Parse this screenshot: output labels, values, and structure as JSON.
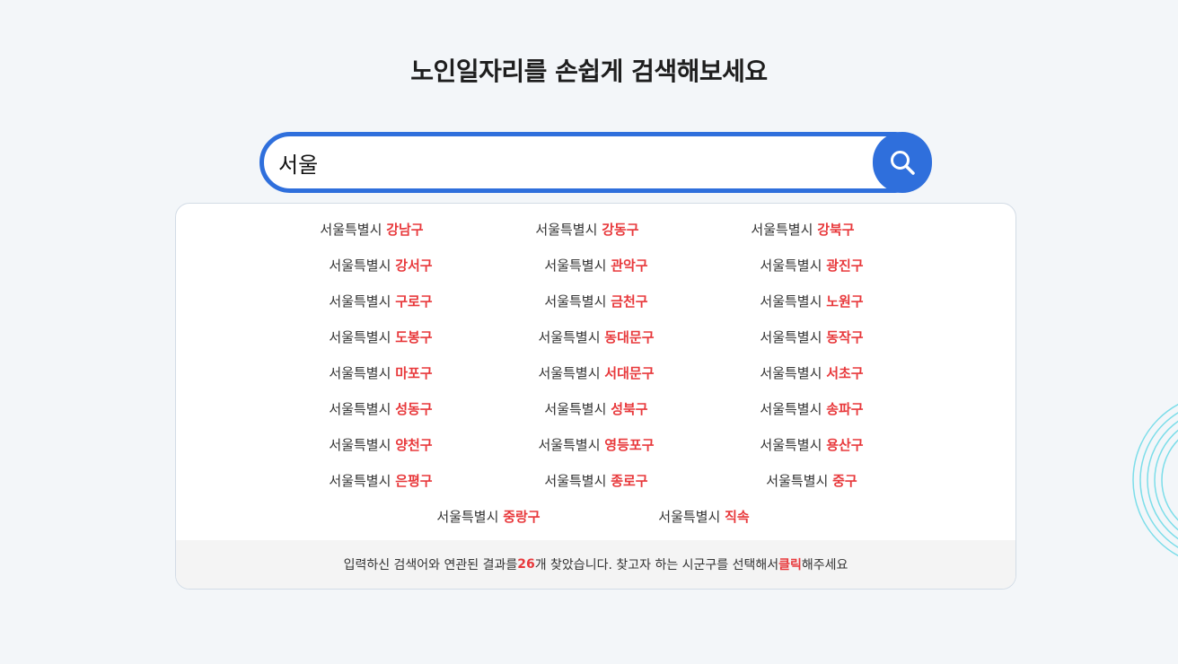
{
  "page": {
    "title": "노인일자리를 손쉽게 검색해보세요"
  },
  "search": {
    "value": "서울"
  },
  "results": [
    {
      "city": "서울특별시",
      "district": "강남구"
    },
    {
      "city": "서울특별시",
      "district": "강동구"
    },
    {
      "city": "서울특별시",
      "district": "강북구"
    },
    {
      "city": "서울특별시",
      "district": "강서구"
    },
    {
      "city": "서울특별시",
      "district": "관악구"
    },
    {
      "city": "서울특별시",
      "district": "광진구"
    },
    {
      "city": "서울특별시",
      "district": "구로구"
    },
    {
      "city": "서울특별시",
      "district": "금천구"
    },
    {
      "city": "서울특별시",
      "district": "노원구"
    },
    {
      "city": "서울특별시",
      "district": "도봉구"
    },
    {
      "city": "서울특별시",
      "district": "동대문구"
    },
    {
      "city": "서울특별시",
      "district": "동작구"
    },
    {
      "city": "서울특별시",
      "district": "마포구"
    },
    {
      "city": "서울특별시",
      "district": "서대문구"
    },
    {
      "city": "서울특별시",
      "district": "서초구"
    },
    {
      "city": "서울특별시",
      "district": "성동구"
    },
    {
      "city": "서울특별시",
      "district": "성북구"
    },
    {
      "city": "서울특별시",
      "district": "송파구"
    },
    {
      "city": "서울특별시",
      "district": "양천구"
    },
    {
      "city": "서울특별시",
      "district": "영등포구"
    },
    {
      "city": "서울특별시",
      "district": "용산구"
    },
    {
      "city": "서울특별시",
      "district": "은평구"
    },
    {
      "city": "서울특별시",
      "district": "종로구"
    },
    {
      "city": "서울특별시",
      "district": "중구"
    },
    {
      "city": "서울특별시",
      "district": "중랑구"
    },
    {
      "city": "서울특별시",
      "district": "직속"
    }
  ],
  "footer": {
    "prefix": "입력하신 검색어와 연관된 결과를 ",
    "count": "26",
    "middle": "개 찾았습니다. 찾고자 하는 시군구를 선택해서 ",
    "click": "클릭",
    "suffix": "해주세요"
  },
  "colors": {
    "accent": "#2f6fdc",
    "highlight": "#e8393c",
    "decoration": "#5fd8e6"
  },
  "icons": {
    "search_button": "search-icon",
    "decoration": "concentric-circles-decoration"
  }
}
